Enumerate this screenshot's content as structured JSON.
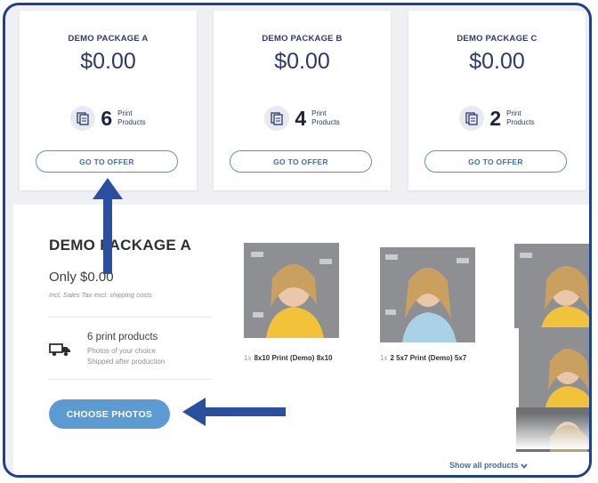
{
  "packages": [
    {
      "name": "DEMO PACKAGE A",
      "price": "$0.00",
      "count": "6",
      "count_label_1": "Print",
      "count_label_2": "Products",
      "cta": "GO TO OFFER"
    },
    {
      "name": "DEMO PACKAGE B",
      "price": "$0.00",
      "count": "4",
      "count_label_1": "Print",
      "count_label_2": "Products",
      "cta": "GO TO OFFER"
    },
    {
      "name": "DEMO PACKAGE C",
      "price": "$0.00",
      "count": "2",
      "count_label_1": "Print",
      "count_label_2": "Products",
      "cta": "GO TO OFFER"
    }
  ],
  "detail": {
    "title": "DEMO PACKAGE A",
    "price_text": "Only $0.00",
    "tax_note": "Incl. Sales Tax excl. shipping costs",
    "prints_count_text": "6 print products",
    "prints_sub_1": "Photos of your choice",
    "prints_sub_2": "Shipped after production",
    "choose_button": "CHOOSE PHOTOS",
    "show_all": "Show all products"
  },
  "products": [
    {
      "qty": "1x",
      "label": "8x10 Print (Demo) 8x10"
    },
    {
      "qty": "1x",
      "label": "2 5x7 Print (Demo) 5x7"
    }
  ],
  "icons": {
    "print": "print-products-icon",
    "truck": "delivery-truck-icon",
    "chevron": "chevron-down-icon",
    "arrow_up": "arrow-up-annotation",
    "arrow_left": "arrow-left-annotation"
  },
  "colors": {
    "frame": "#1f3f8f",
    "accent": "#5c9bd1",
    "link": "#3e6db5",
    "annotation_arrow": "#2a4f9e"
  }
}
